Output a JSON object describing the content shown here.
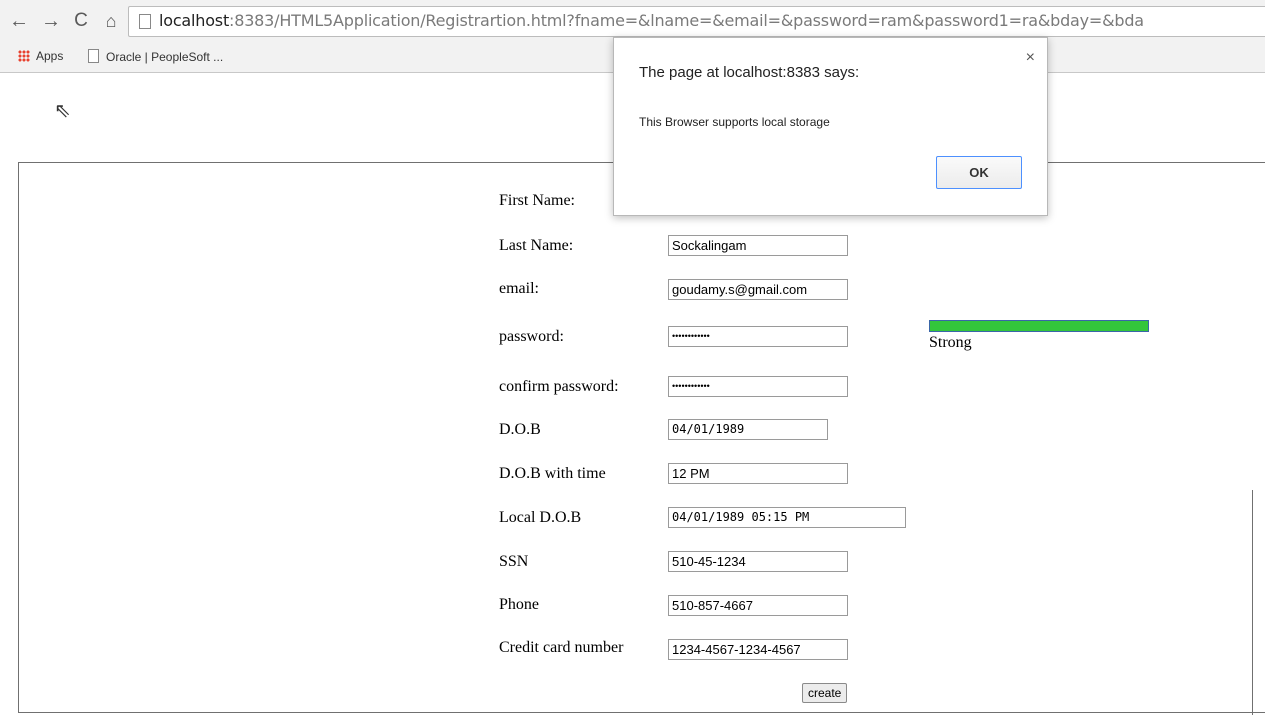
{
  "browser": {
    "url_host": "localhost",
    "url_rest": ":8383/HTML5Application/Registrartion.html?fname=&lname=&email=&password=ram&password1=ra&bday=&bda",
    "bookmarks": [
      {
        "label": "Apps",
        "icon": "apps-grid-icon"
      },
      {
        "label": "Oracle | PeopleSoft ...",
        "icon": "page-icon"
      }
    ]
  },
  "form": {
    "fields": [
      {
        "label": "First Name:",
        "value": ""
      },
      {
        "label": "Last Name:",
        "value": "Sockalingam"
      },
      {
        "label": "email:",
        "value": "goudamy.s@gmail.com"
      },
      {
        "label": "password:",
        "value": "••••••••••••"
      },
      {
        "label": "confirm password:",
        "value": "••••••••••••"
      },
      {
        "label": "D.O.B",
        "value": "04/01/1989"
      },
      {
        "label": "D.O.B with time",
        "value": "12 PM"
      },
      {
        "label": "Local D.O.B",
        "value": "04/01/1989 05:15 PM"
      },
      {
        "label": "SSN",
        "value": "510-45-1234"
      },
      {
        "label": "Phone",
        "value": "510-857-4667"
      },
      {
        "label": "Credit card number",
        "value": "1234-4567-1234-4567"
      }
    ],
    "password_strength": {
      "label": "Strong",
      "level": 1.0,
      "color": "#33c63b"
    },
    "create_label": "create"
  },
  "dialog": {
    "title": "The page at localhost:8383 says:",
    "message": "This Browser supports local storage",
    "ok_label": "OK",
    "close_glyph": "×"
  }
}
